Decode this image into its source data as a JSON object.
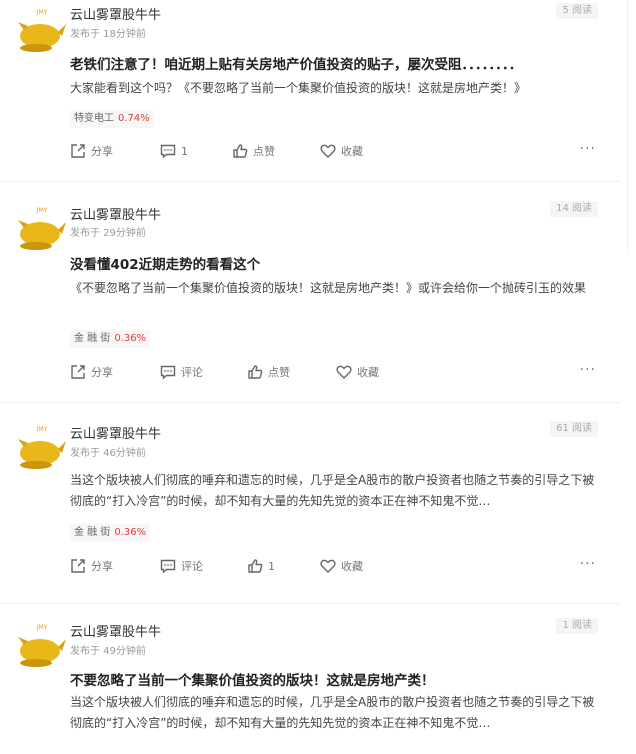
{
  "posts": [
    {
      "username": "云山雾罩股牛牛",
      "time": "发布于  18分钟前",
      "reads": "5 阅读",
      "title": "老铁们注意了！咱近期上贴有关房地产价值投资的贴子，屡次受阻．．．．．．．．",
      "body": "大家能看到这个吗？《不要忽略了当前一个集聚价值投资的版块！这就是房地产类！》",
      "stock": {
        "name": "特变电工",
        "change": "0.74%"
      },
      "actions": {
        "share": "分享",
        "comment": "1",
        "like": "点赞",
        "favorite": "收藏"
      }
    },
    {
      "username": "云山雾罩股牛牛",
      "time": "发布于  29分钟前",
      "reads": "14 阅读",
      "title": "没看懂402近期走势的看看这个",
      "body": "《不要忽略了当前一个集聚价值投资的版块！这就是房地产类！》或许会给你一个抛砖引玉的效果",
      "stock": {
        "name": "金 融 街",
        "change": "0.36%"
      },
      "actions": {
        "share": "分享",
        "comment": "评论",
        "like": "点赞",
        "favorite": "收藏"
      }
    },
    {
      "username": "云山雾罩股牛牛",
      "time": "发布于  46分钟前",
      "reads": "61 阅读",
      "title": "",
      "body": "当这个版块被人们彻底的唾弃和遗忘的时候，几乎是全A股市的散户投资者也随之节奏的引导之下被彻底的“打入冷宫”的时候，却不知有大量的先知先觉的资本正在神不知鬼不觉…",
      "stock": {
        "name": "金 融 街",
        "change": "0.36%"
      },
      "actions": {
        "share": "分享",
        "comment": "评论",
        "like": "1",
        "favorite": "收藏"
      }
    },
    {
      "username": "云山雾罩股牛牛",
      "time": "发布于  49分钟前",
      "reads": "1 阅读",
      "title": "不要忽略了当前一个集聚价值投资的版块！这就是房地产类！",
      "body": "当这个版块被人们彻底的唾弃和遗忘的时候，几乎是全A股市的散户投资者也随之节奏的引导之下被彻底的“打入冷宫”的时候，却不知有大量的先知先觉的资本正在神不知鬼不觉…"
    }
  ],
  "colors": {
    "accent_red": "#e63b3b",
    "avatar_gold": "#e8b81a",
    "muted": "#999999"
  }
}
